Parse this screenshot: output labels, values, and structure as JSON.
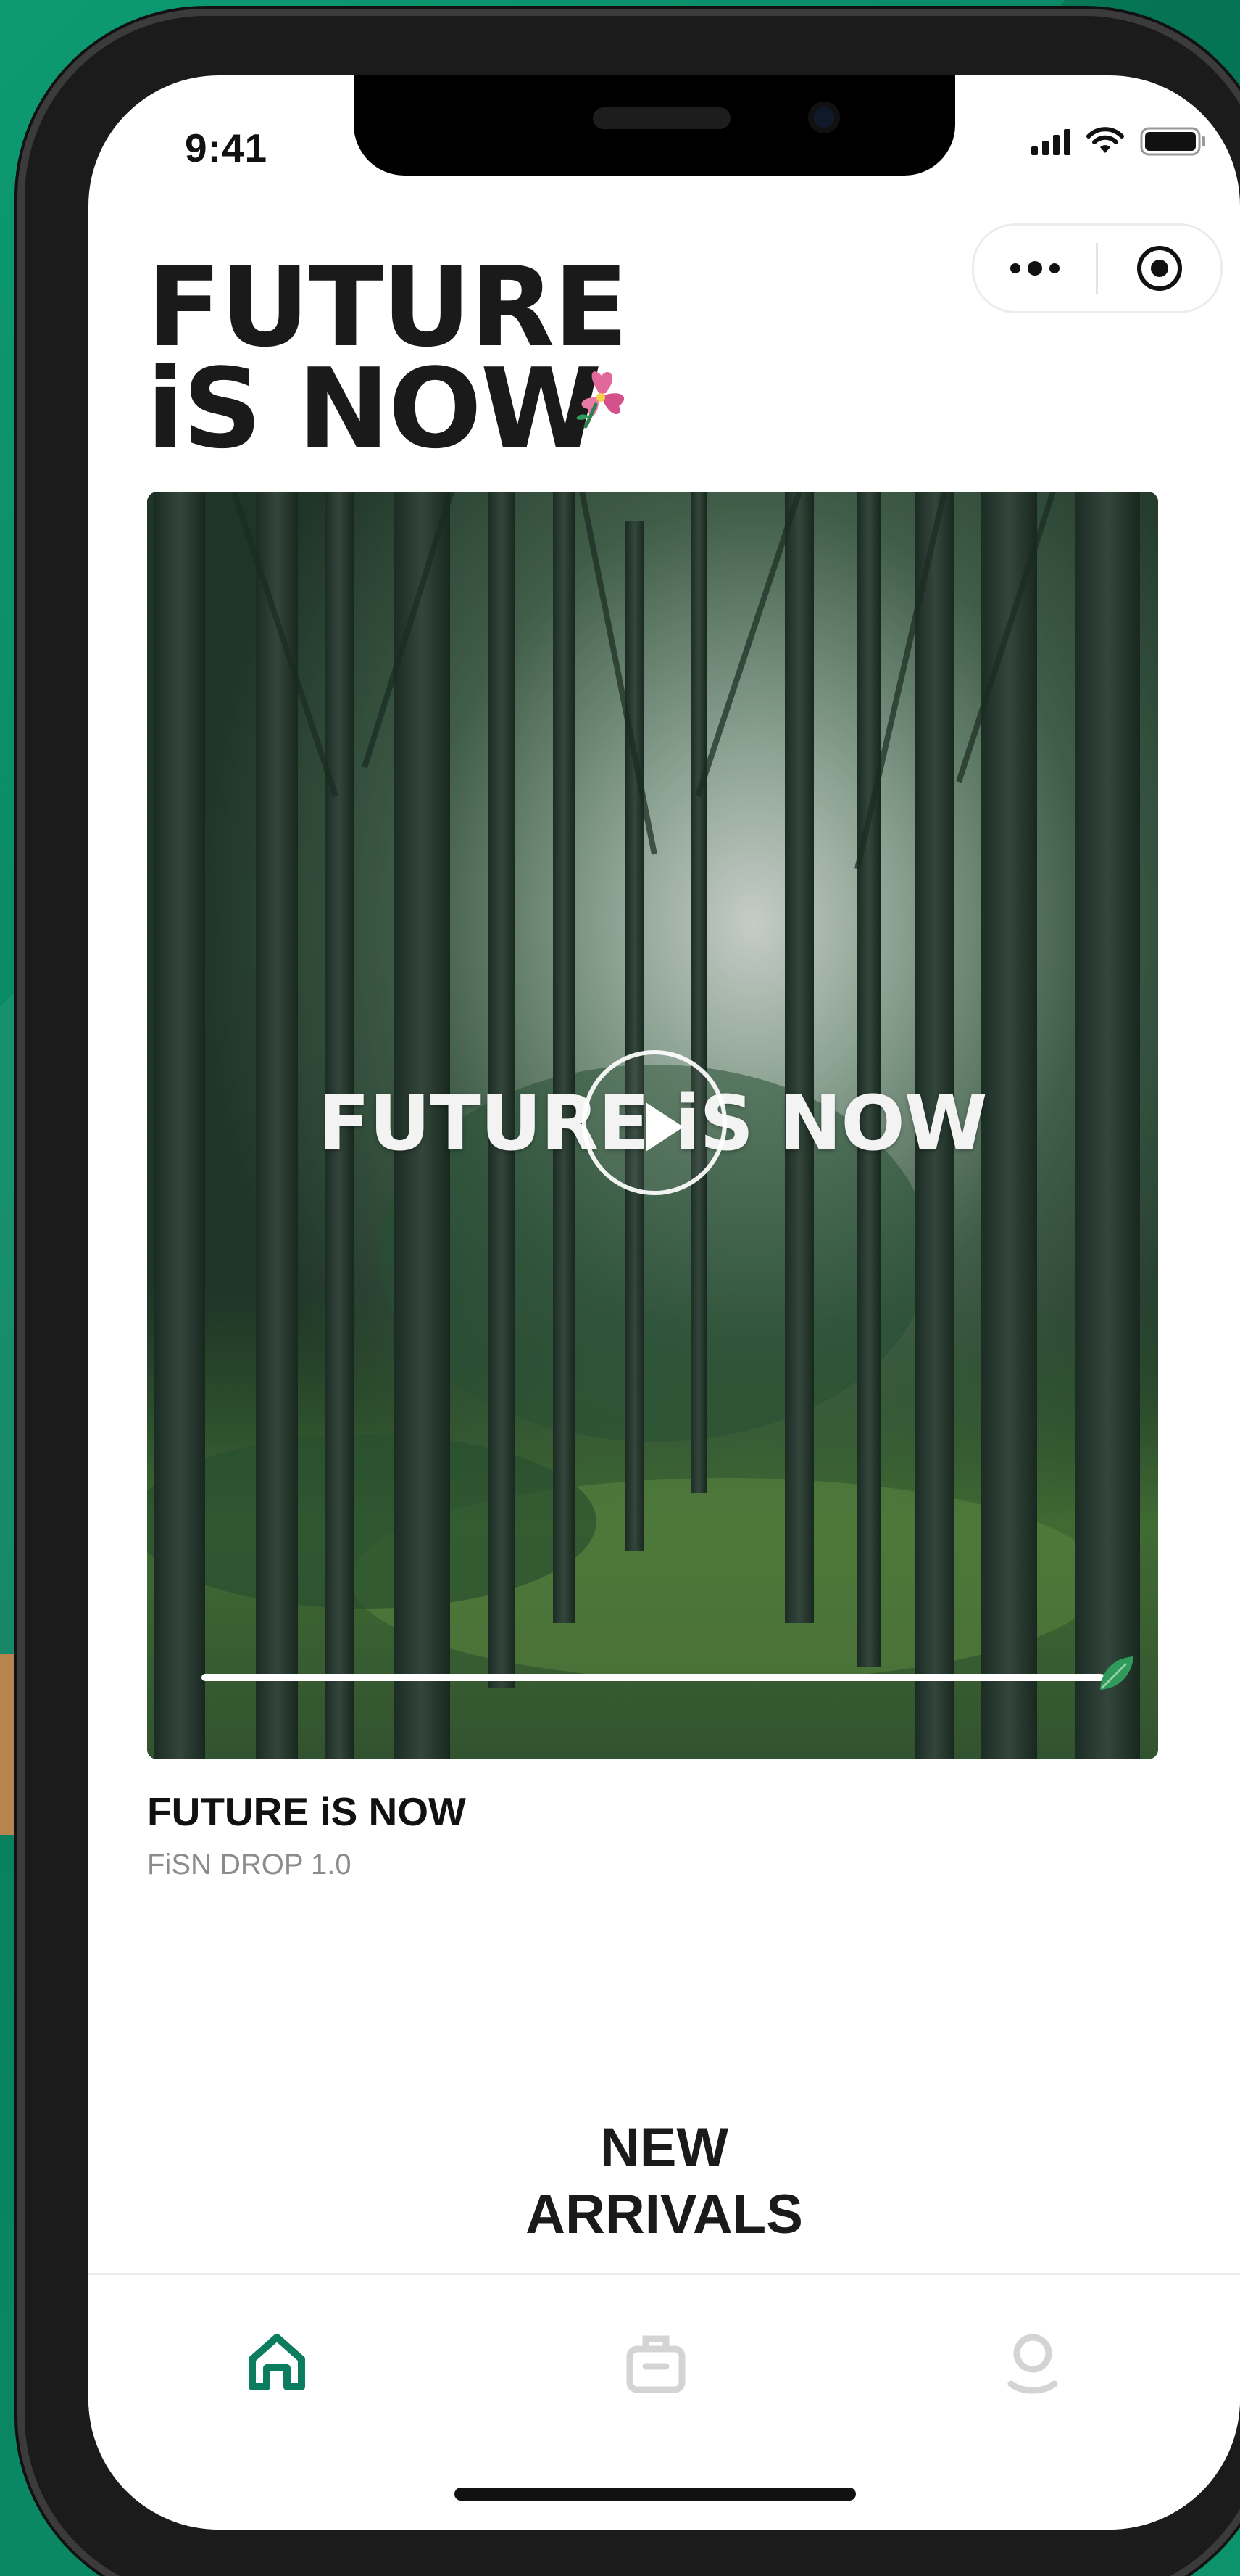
{
  "status_bar": {
    "time": "9:41"
  },
  "capsule": {
    "more_icon": "more-dots-icon",
    "close_icon": "target-icon"
  },
  "brand": {
    "logo_line1": "FUTURE",
    "logo_line2": "iS NOW",
    "logo_icon": "flower-icon"
  },
  "hero": {
    "overlay_title": "FUTURE iS NOW",
    "play_icon": "play-icon",
    "progress": 0.98,
    "caption_title": "FUTURE iS NOW",
    "caption_subtitle": "FiSN DROP 1.0"
  },
  "section": {
    "title_line1": "NEW",
    "title_line2": "ARRIVALS"
  },
  "tabbar": {
    "items": [
      {
        "icon": "home-icon",
        "active": true
      },
      {
        "icon": "bag-icon",
        "active": false
      },
      {
        "icon": "profile-icon",
        "active": false
      }
    ],
    "active_color": "#0b7d5e",
    "inactive_color": "#d4d4d4"
  },
  "colors": {
    "background": "#0a8a67",
    "brand_green": "#0b7d5e"
  }
}
